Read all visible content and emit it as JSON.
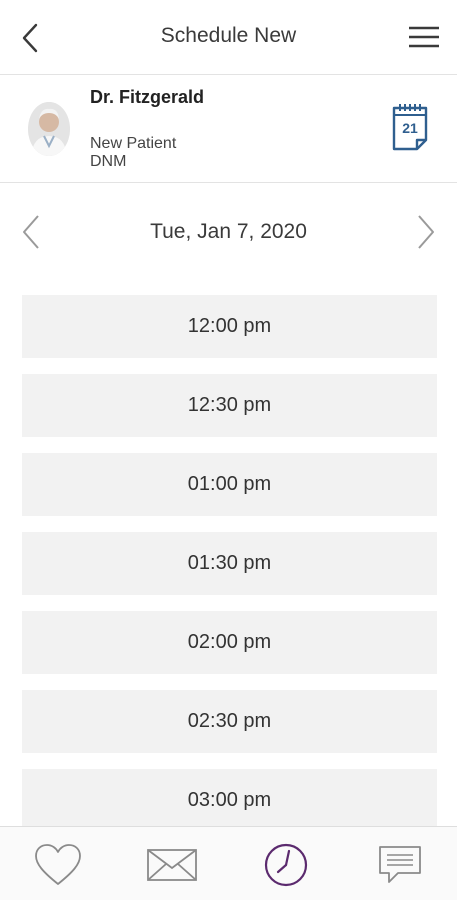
{
  "header": {
    "title": "Schedule New",
    "back_icon": "chevron-left-icon",
    "menu_icon": "hamburger-menu-icon"
  },
  "doctor": {
    "name": "Dr. Fitzgerald",
    "patient_type": "New Patient",
    "code": "DNM",
    "calendar_day": "21"
  },
  "date_nav": {
    "date": "Tue, Jan 7, 2020",
    "prev_icon": "chevron-left-icon",
    "next_icon": "chevron-right-icon"
  },
  "slots": [
    "12:00 pm",
    "12:30 pm",
    "01:00 pm",
    "01:30 pm",
    "02:00 pm",
    "02:30 pm",
    "03:00 pm"
  ],
  "tabbar": {
    "items": [
      {
        "icon": "heart-icon"
      },
      {
        "icon": "mail-icon"
      },
      {
        "icon": "clock-icon",
        "active": true
      },
      {
        "icon": "chat-icon"
      }
    ]
  },
  "colors": {
    "accent": "#5b2a6e",
    "calendar": "#2f5f8f",
    "slot_bg": "#f2f2f2",
    "icon_gray": "#8a8a8a"
  }
}
